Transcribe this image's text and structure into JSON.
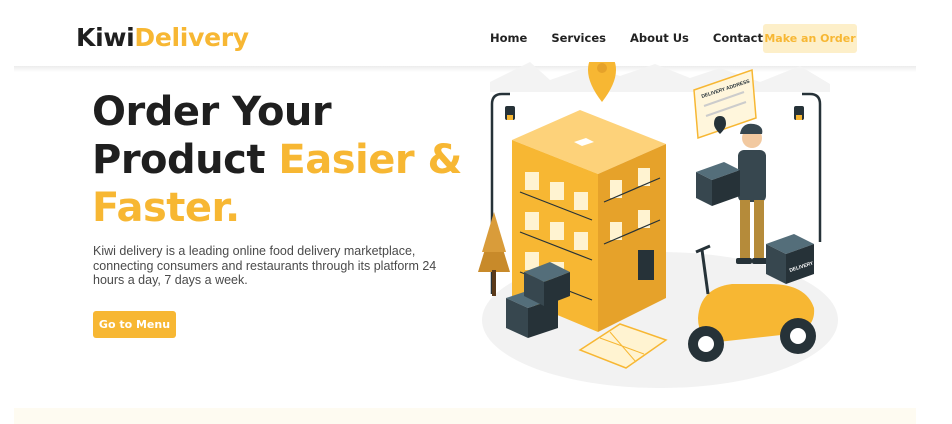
{
  "brand": {
    "part1": "Kiwi",
    "part2": "Delivery"
  },
  "nav": {
    "links": [
      "Home",
      "Services",
      "About Us",
      "Contact Us"
    ],
    "order_button": "Make an Order"
  },
  "hero": {
    "title_line1": "Order Your",
    "title_line2": "Product ",
    "title_highlight1": "Easier &",
    "title_highlight2": "Faster.",
    "description": "Kiwi delivery is a leading online food delivery marketplace, connecting consumers and restaurants through its platform 24 hours a day, 7 days a week.",
    "cta_button": "Go to Menu"
  },
  "illustration": {
    "sign_text": "DELIVERY ADDRESS",
    "box_text": "DELIVERY"
  },
  "colors": {
    "accent": "#f7b733",
    "accent_light": "#fdefc9",
    "dark": "#1f1f1f",
    "box": "#37474f"
  }
}
